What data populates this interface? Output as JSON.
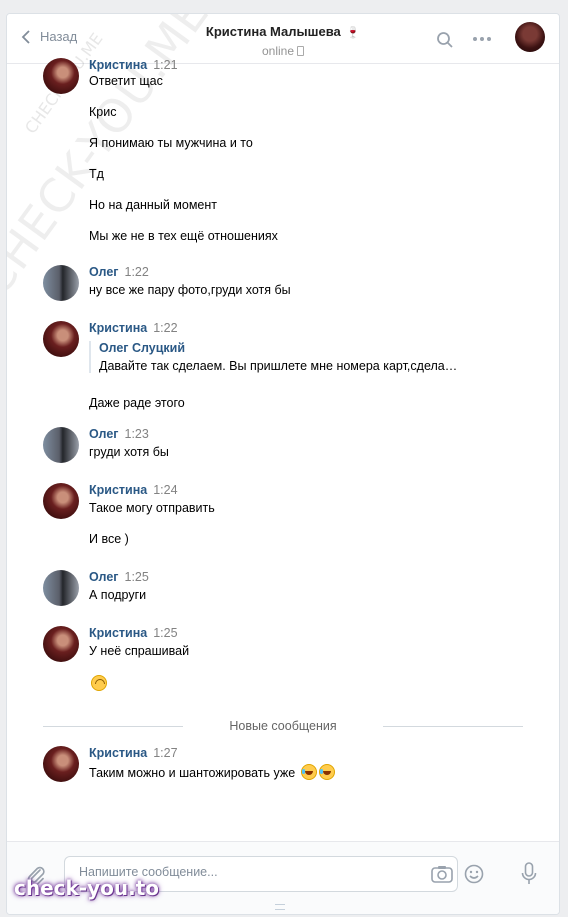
{
  "header": {
    "back_label": "Назад",
    "contact_name": "Кристина Малышева",
    "name_emoji": "🍷",
    "status": "online"
  },
  "messages": [
    {
      "author": "Кристина",
      "time": "1:21",
      "lines": [
        "Ответит щас",
        "Крис",
        "Я понимаю ты мужчина и то",
        "Тд",
        "Но на данный момент",
        "Мы же не в тех ещё отношениях"
      ]
    },
    {
      "author": "Олег",
      "time": "1:22",
      "lines": [
        "ну все же пару фото,груди хотя бы"
      ]
    },
    {
      "author": "Кристина",
      "time": "1:22",
      "quote": {
        "author": "Олег Слуцкий",
        "text": "Давайте так сделаем. Вы пришлете мне номера карт,сдела…"
      },
      "lines": [
        "Даже раде этого"
      ]
    },
    {
      "author": "Олег",
      "time": "1:23",
      "lines": [
        "груди хотя бы"
      ]
    },
    {
      "author": "Кристина",
      "time": "1:24",
      "lines": [
        "Такое могу отправить",
        "И все )"
      ]
    },
    {
      "author": "Олег",
      "time": "1:25",
      "lines": [
        "А подруги"
      ]
    },
    {
      "author": "Кристина",
      "time": "1:25",
      "lines": [
        "У неё спрашивай"
      ],
      "emoji": "upside-down-face"
    },
    {
      "author": "Кристина",
      "time": "1:27",
      "lines": [
        "Таким можно и шантожировать уже"
      ],
      "emoji": "joy-x2"
    }
  ],
  "divider_label": "Новые сообщения",
  "composer": {
    "placeholder": "Напишите сообщение..."
  },
  "watermarks": {
    "diagonal": "CHECK-YOU.ME",
    "small": "CHECK-YOU.ME",
    "bottom": "check-you.to"
  },
  "colors": {
    "name_link": "#2a5885",
    "background": "#edeef0",
    "divider": "#d3d9de"
  }
}
